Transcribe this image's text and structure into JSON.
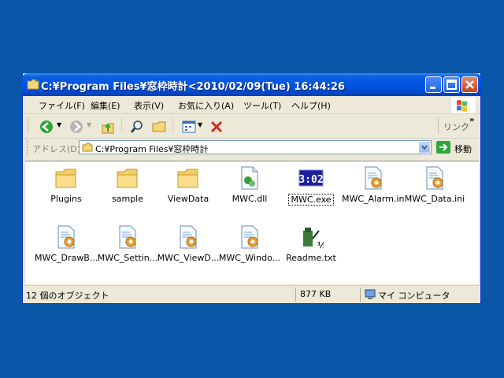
{
  "window": {
    "title": "C:¥Program Files¥窓枠時計<2010/02/09(Tue) 16:44:26"
  },
  "menu": [
    "ファイル(F)",
    "編集(E)",
    "表示(V)",
    "お気に入り(A)",
    "ツール(T)",
    "ヘルプ(H)"
  ],
  "toolbar": {
    "links_label": "リンク"
  },
  "address": {
    "label": "アドレス(D)",
    "value": "C:¥Program Files¥窓枠時計",
    "go_label": "移動"
  },
  "files": [
    {
      "name": "Plugins",
      "icon": "folder-icon"
    },
    {
      "name": "sample",
      "icon": "folder-icon"
    },
    {
      "name": "ViewData",
      "icon": "folder-icon"
    },
    {
      "name": "MWC.dll",
      "icon": "dll-file-icon"
    },
    {
      "name": "MWC.exe",
      "icon": "clock-app-icon",
      "icon_text": "3:02"
    },
    {
      "name": "MWC_Alarm.ini",
      "icon": "ini-file-icon"
    },
    {
      "name": "MWC_Data.ini",
      "icon": "ini-file-icon"
    },
    {
      "name": "MWC_DrawB...",
      "icon": "ini-file-icon"
    },
    {
      "name": "MWC_Settin...",
      "icon": "ini-file-icon"
    },
    {
      "name": "MWC_ViewD...",
      "icon": "ini-file-icon"
    },
    {
      "name": "MWC_Windo...",
      "icon": "ini-file-icon"
    },
    {
      "name": "Readme.txt",
      "icon": "text-file-icon"
    }
  ],
  "status": {
    "count": "12 個のオブジェクト",
    "size": "877 KB",
    "location": "マイ コンピュータ"
  },
  "colors": {
    "desktop": "#0a56a8",
    "titlebar": "#0054e3",
    "window_bg": "#ece9d8",
    "folder": "#f5d77a"
  }
}
